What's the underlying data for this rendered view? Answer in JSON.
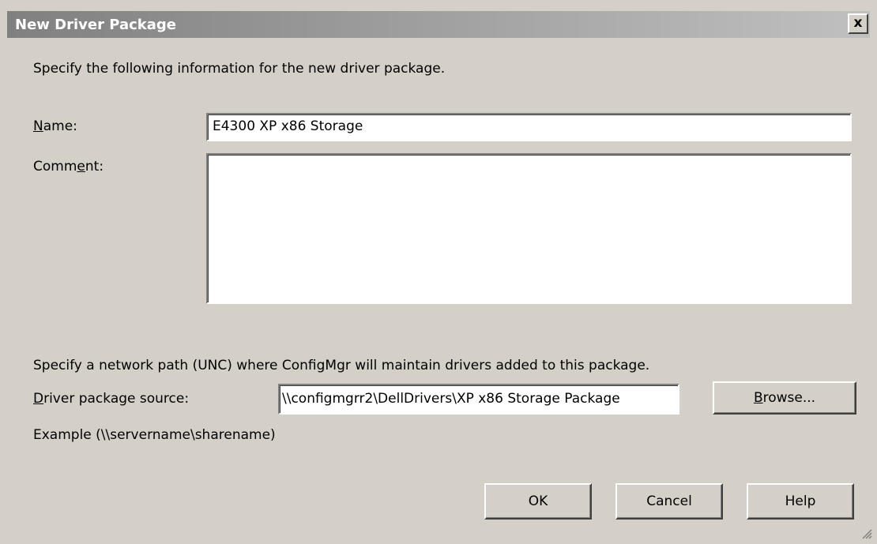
{
  "window": {
    "title": "New Driver Package",
    "close_label": "x"
  },
  "intro_text": "Specify the following information for the new driver package.",
  "name_field": {
    "label_key": "N",
    "label_rest": "ame:",
    "value": "E4300 XP x86 Storage"
  },
  "comment_field": {
    "label_pre": "Comm",
    "label_key": "e",
    "label_post": "nt:",
    "value": ""
  },
  "network_text": "Specify a network path (UNC) where ConfigMgr will maintain drivers added to this package.",
  "source_field": {
    "label_key": "D",
    "label_rest": "river package source:",
    "value": "\\\\configmgrr2\\DellDrivers\\XP x86 Storage Package"
  },
  "browse_button": {
    "label_key": "B",
    "label_rest": "rowse..."
  },
  "example_text": "Example (\\\\servername\\sharename)",
  "buttons": {
    "ok": "OK",
    "cancel": "Cancel",
    "help": "Help"
  }
}
